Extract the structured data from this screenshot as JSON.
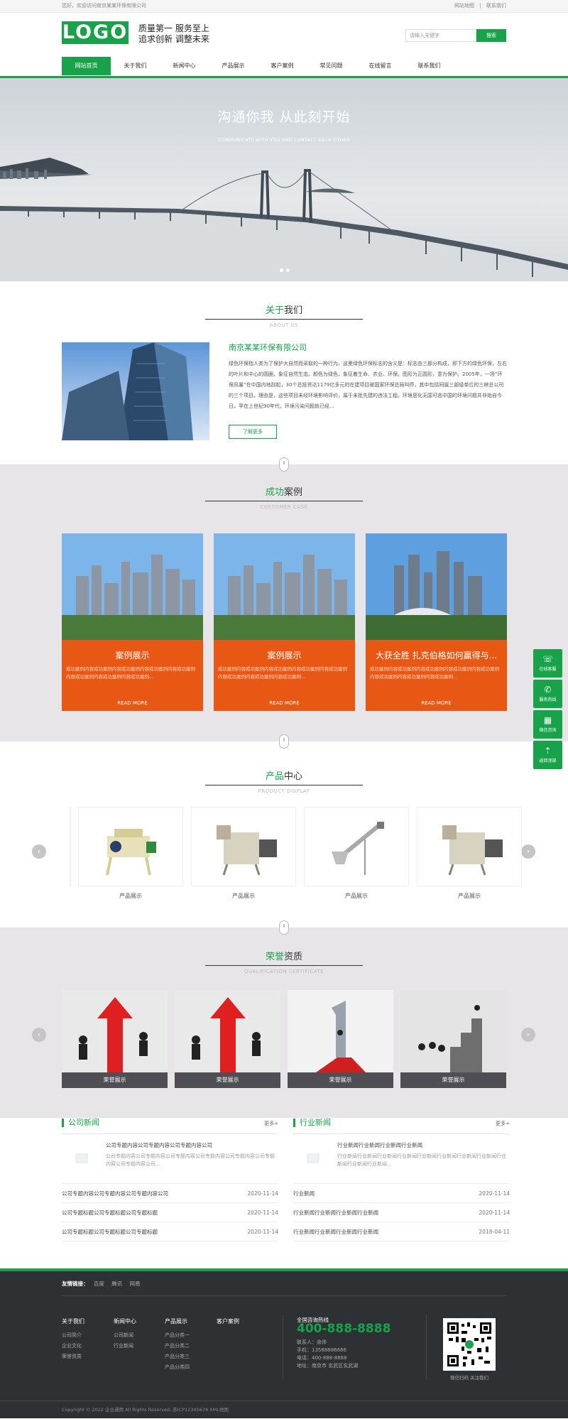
{
  "topbar": {
    "welcome": "您好，欢迎访问南京某某环保有限公司",
    "links": [
      "网站地图",
      "|",
      "联系我们"
    ]
  },
  "header": {
    "logo": "LOGO",
    "slogan1": "质量第一  服务至上",
    "slogan2": "追求创新  调整未来",
    "search_placeholder": "请输入关键字",
    "search_button": "搜索"
  },
  "nav": [
    "网站首页",
    "关于我们",
    "新闻中心",
    "产品展示",
    "客户案例",
    "常见问题",
    "在线留言",
    "联系我们"
  ],
  "banner": {
    "title": "沟通你我  从此刻开始",
    "subtitle": "COMMUNICATE WITH YOU AND CONTACT EACH OTHER"
  },
  "about": {
    "title_green": "关于",
    "title_rest": "我们",
    "title_en": "ABOUT US",
    "company": "南京某某环保有限公司",
    "text": "绿色环保指人类为了保护大自然而采取的一种行为。这里绿色环保标志的含义是：标志由三部分构成，即下方的绿色环保，左右的叶片和中心的圆圈，象征自然生态。颜色为绿色，象征着生命、农业、环保。图形为正圆形，意为保护。2005年，一场“环保风暴”在中国内地刮起，30个总投资达1179亿多元的在建项目被国家环保总局叫停，其中包括同属三部级单位的三峡总公司的三个项目。理由是，这些项目未经环境影响评价，属于未批先建的违法工程。环境恶化无国可逃中国的环境问题并非始自今日。早在上世纪90年代，环境污染问题就已经...",
    "more": "了解更多"
  },
  "cases": {
    "title_green": "成功",
    "title_rest": "案例",
    "title_en": "CUSTOMER CASE",
    "items": [
      {
        "title": "案例展示",
        "desc": "成功案例内容成功案例内容成功案例内容成功案例内容成功案例内容成功案例内容成功案例内容成功案例...",
        "more": "READ MORE"
      },
      {
        "title": "案例展示",
        "desc": "成功案例内容成功案例内容成功案例内容成功案例内容成功案例内容成功案例内容成功案例内容成功案例...",
        "more": "READ MORE"
      },
      {
        "title": "大获全胜 扎克伯格如何赢得与...",
        "desc": "成功案例内容成功案例内容成功案例内容成功案例内容成功案例内容成功案例内容成功案例内容成功案例...",
        "more": "READ MORE"
      }
    ]
  },
  "products": {
    "title_green": "产品",
    "title_rest": "中心",
    "title_en": "PRODUCT DISPLAY",
    "items": [
      "产品展示",
      "产品展示",
      "产品展示",
      "产品展示"
    ]
  },
  "honors": {
    "title_green": "荣誉",
    "title_rest": "资质",
    "title_en": "QUALIFICATION CERTIFICATE",
    "items": [
      "荣誉展示",
      "荣誉展示",
      "荣誉展示",
      "荣誉展示"
    ]
  },
  "news": [
    {
      "title": "公司新闻",
      "more": "更多+",
      "top_title": "公司专题内容公司专题内容公司专题内容公司",
      "top_desc": "公司专题内容公司专题内容公司专题内容公司专题内容公司专题内容公司专题内容公司专题内容公司...",
      "rows": [
        {
          "t": "公司专题内容公司专题内容公司专题内容公司",
          "d": "2020-11-14"
        },
        {
          "t": "公司专题标题公司专题标题公司专题标题",
          "d": "2020-11-14"
        },
        {
          "t": "公司专题标题公司专题标题公司专题标题",
          "d": "2020-11-14"
        }
      ]
    },
    {
      "title": "行业新闻",
      "more": "更多+",
      "top_title": "行业新闻行业新闻行业新闻行业新闻",
      "top_desc": "行业新闻行业新闻行业新闻行业新闻行业新闻行业新闻行业新闻行业新闻行业新闻行业新闻行业新闻...",
      "rows": [
        {
          "t": "行业新闻",
          "d": "2020-11-14"
        },
        {
          "t": "行业新闻行业新闻行业新闻行业新闻",
          "d": "2020-11-14"
        },
        {
          "t": "行业新闻行业新闻行业新闻行业新闻",
          "d": "2018-04-11"
        }
      ]
    }
  ],
  "footer": {
    "links_label": "友情链接：",
    "links": [
      "百度",
      "腾讯",
      "网易"
    ],
    "cols": [
      {
        "h": "关于我们",
        "items": [
          "公司简介",
          "企业文化",
          "荣誉资质"
        ]
      },
      {
        "h": "新闻中心",
        "items": [
          "公司新闻",
          "行业新闻"
        ]
      },
      {
        "h": "产品展示",
        "items": [
          "产品分类一",
          "产品分类二",
          "产品分类三",
          "产品分类四"
        ]
      },
      {
        "h": "客户案例",
        "items": []
      }
    ],
    "hotline_label": "全国咨询热线",
    "hotline": "400-888-8888",
    "contact": [
      "联系人：余帅",
      "手机：13588886666",
      "电话：400-888-8888",
      "地址：南京市 玄武区玄武湖"
    ],
    "qr_caption": "微信扫码 关注我们",
    "copyright": "Copyright © 2022 企业通用 All Rights Reserved.   苏ICP12345678   XML地图"
  },
  "side": [
    "在线客服",
    "服务热线",
    "微信咨询",
    "返回顶部"
  ]
}
